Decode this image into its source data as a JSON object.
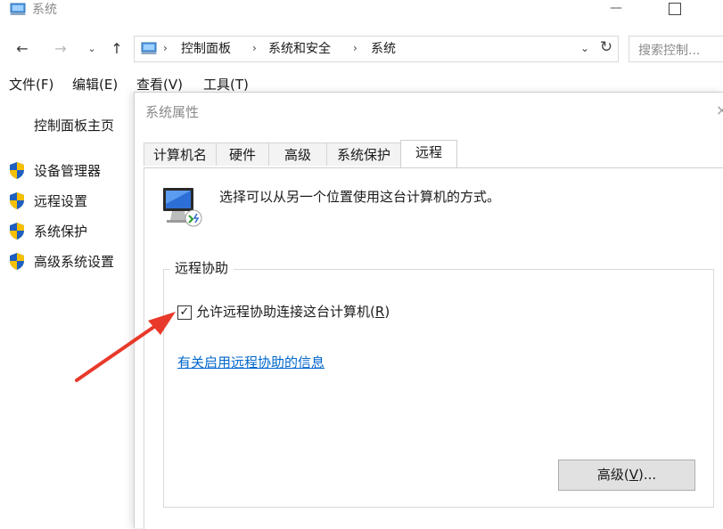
{
  "window": {
    "title": "系统",
    "minimize_glyph": "—"
  },
  "nav": {
    "back_glyph": "←",
    "forward_glyph": "→",
    "recent_glyph": "⌄",
    "up_glyph": "↑"
  },
  "address": {
    "separator": "›",
    "crumbs": [
      "控制面板",
      "系统和安全",
      "系统"
    ],
    "dropdown_glyph": "⌄",
    "refresh_glyph": "↻"
  },
  "search": {
    "placeholder": "搜索控制..."
  },
  "menubar": {
    "items": [
      "文件(F)",
      "编辑(E)",
      "查看(V)",
      "工具(T)"
    ]
  },
  "sidebar": {
    "home": "控制面板主页",
    "links": [
      "设备管理器",
      "远程设置",
      "系统保护",
      "高级系统设置"
    ]
  },
  "dialog": {
    "title": "系统属性",
    "close_glyph": "×",
    "tabs": [
      "计算机名",
      "硬件",
      "高级",
      "系统保护",
      "远程"
    ],
    "active_tab": "远程",
    "description": "选择可以从另一个位置使用这台计算机的方式。",
    "remote_assistance": {
      "legend": "远程协助",
      "checkbox_label": "允许远程协助连接这台计算机",
      "checkbox_mnemonic": "R",
      "checkbox_checked": true,
      "checkbox_glyph": "✓",
      "info_link": "有关启用远程协助的信息",
      "advanced_button": "高级",
      "advanced_mnemonic": "V",
      "advanced_suffix": "..."
    }
  },
  "colors": {
    "link": "#0066cc",
    "annotation_arrow": "#e8392a",
    "shield_blue": "#1f5fbf",
    "shield_yellow": "#f5c000"
  }
}
